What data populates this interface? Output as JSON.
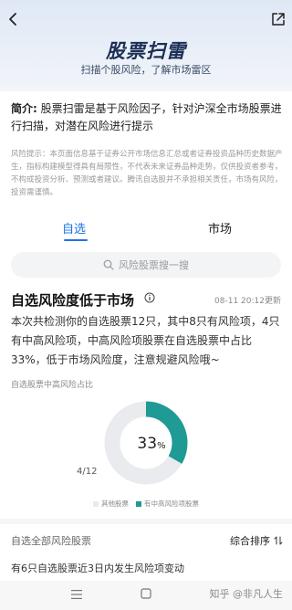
{
  "header": {
    "title": "股票扫雷",
    "subtitle": "扫描个股风险，了解市场雷区",
    "back_icon": "chevron-left-icon",
    "share_icon": "share-external-icon"
  },
  "intro": {
    "label": "简介:",
    "text": "股票扫雷是基于风险因子，针对沪深全市场股票进行扫描，对潜在风险进行提示"
  },
  "disclaimer": "风险提示：本页面信息基于证券公开市场信息汇总或者证券投资品种历史数据产生，指标构建模型得具有局限性，不代表未来证券品种走势，仅供投资者参考，不构成投资分析、预测或者建议。腾讯自选股并不承担相关责任，市场有风险，投资需谨慎。",
  "tabs": [
    {
      "label": "自选",
      "active": true
    },
    {
      "label": "市场",
      "active": false
    }
  ],
  "search": {
    "placeholder": "风险股票搜一搜"
  },
  "section": {
    "title": "自选风险度低于市场",
    "update_time": "08-11 20:12更新",
    "summary": "本次共检测你的自选股票12只，其中8只有风险项，4只有中高风险项，中高风险项股票在自选股票中占比33%，低于市场风险度，注意规避风险哦~",
    "chart_caption": "自选股票中高风险占比"
  },
  "donut": {
    "percent_value": "33",
    "percent_unit": "%",
    "count_label": "4/12",
    "fraction": 0.3333,
    "accent_color": "#1f9a95",
    "track_color": "#e9ebef"
  },
  "legend": [
    {
      "label": "其他股票",
      "color": "#e9ebef"
    },
    {
      "label": "有中高风险项股票",
      "color": "#1f9a95"
    }
  ],
  "list": {
    "header": "自选全部风险股票",
    "sort_label": "综合排序",
    "notice": "有6只自选股票近3日内发生风险项变动"
  },
  "watermark": "知乎 @非凡人生"
}
